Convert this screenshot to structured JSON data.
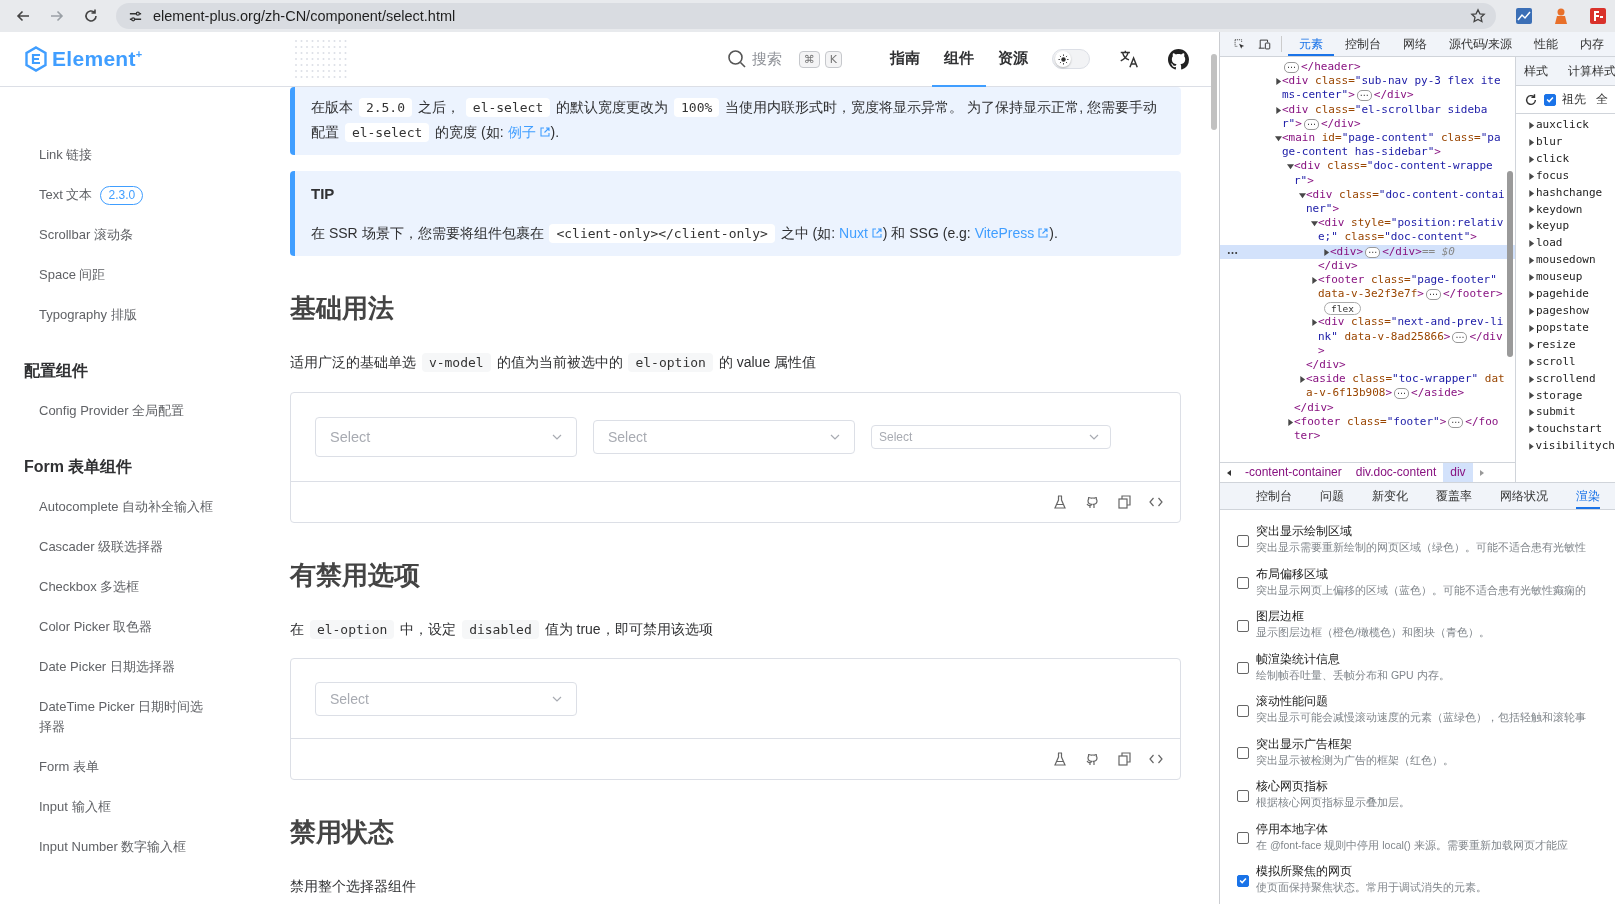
{
  "browser": {
    "url": "element-plus.org/zh-CN/component/select.html"
  },
  "header": {
    "logo": "Element$^{+}$",
    "search": {
      "label": "搜索",
      "keys": [
        "⌘",
        "K"
      ]
    },
    "nav": [
      {
        "label": "指南",
        "selected": false
      },
      {
        "label": "组件",
        "selected": true
      },
      {
        "label": "资源",
        "selected": false
      }
    ],
    "dark_mode": false
  },
  "sidebar": {
    "sections": [
      {
        "items": [
          {
            "label": "Link 链接"
          },
          {
            "label": "Text 文本",
            "badge": "2.3.0"
          },
          {
            "label": "Scrollbar 滚动条"
          },
          {
            "label": "Space 间距"
          },
          {
            "label": "Typography 排版"
          }
        ]
      },
      {
        "title": "配置组件",
        "items": [
          {
            "label": "Config Provider 全局配置"
          }
        ]
      },
      {
        "title": "Form 表单组件",
        "items": [
          {
            "label": "Autocomplete 自动补全输入框"
          },
          {
            "label": "Cascader 级联选择器"
          },
          {
            "label": "Checkbox 多选框"
          },
          {
            "label": "Color Picker 取色器"
          },
          {
            "label": "Date Picker 日期选择器"
          },
          {
            "label": "DateTime Picker 日期时间选择器"
          },
          {
            "label": "Form 表单"
          },
          {
            "label": "Input 输入框"
          },
          {
            "label": "Input Number 数字输入框"
          }
        ]
      }
    ]
  },
  "content": [
    {
      "kind": "callout",
      "segments": [
        {
          "kind": "text",
          "text": "在版本 "
        },
        {
          "kind": "code",
          "text": "2.5.0"
        },
        {
          "kind": "text",
          "text": " 之后， "
        },
        {
          "kind": "code",
          "text": "el-select"
        },
        {
          "kind": "text",
          "text": " 的默认宽度更改为 "
        },
        {
          "kind": "code",
          "text": "100%"
        },
        {
          "kind": "text",
          "text": " 当使用内联形式时，宽度将显示异常。 为了保持显示正常, 您需要手动配置 "
        },
        {
          "kind": "code",
          "text": "el-select"
        },
        {
          "kind": "text",
          "text": " 的宽度 (如: "
        },
        {
          "kind": "link",
          "text": "例子"
        },
        {
          "kind": "text",
          "text": ")."
        }
      ]
    },
    {
      "kind": "callout",
      "title": "TIP",
      "segments": [
        {
          "kind": "text",
          "text": "在 SSR 场景下，您需要将组件包裹在 "
        },
        {
          "kind": "code",
          "text": "<client-only></client-only>"
        },
        {
          "kind": "text",
          "text": " 之中 (如: "
        },
        {
          "kind": "link",
          "text": "Nuxt"
        },
        {
          "kind": "text",
          "text": ") 和 SSG (e.g: "
        },
        {
          "kind": "link",
          "text": "VitePress"
        },
        {
          "kind": "text",
          "text": ")."
        }
      ]
    },
    {
      "kind": "heading",
      "text": "基础用法"
    },
    {
      "kind": "paragraph",
      "segments": [
        {
          "kind": "text",
          "text": "适用广泛的基础单选 "
        },
        {
          "kind": "code",
          "text": "v-model"
        },
        {
          "kind": "text",
          "text": " 的值为当前被选中的 "
        },
        {
          "kind": "code",
          "text": "el-option"
        },
        {
          "kind": "text",
          "text": " 的 value 属性值"
        }
      ]
    },
    {
      "kind": "demo",
      "selects": [
        {
          "placeholder": "Select",
          "kind": "large"
        },
        {
          "placeholder": "Select",
          "kind": "default"
        },
        {
          "placeholder": "Select",
          "kind": "small"
        }
      ]
    },
    {
      "kind": "heading",
      "text": "有禁用选项"
    },
    {
      "kind": "paragraph",
      "segments": [
        {
          "kind": "text",
          "text": "在 "
        },
        {
          "kind": "code",
          "text": "el-option"
        },
        {
          "kind": "text",
          "text": " 中，设定 "
        },
        {
          "kind": "code",
          "text": "disabled"
        },
        {
          "kind": "text",
          "text": " 值为 true，即可禁用该选项"
        }
      ]
    },
    {
      "kind": "demo",
      "selects": [
        {
          "placeholder": "Select",
          "kind": "default"
        }
      ]
    },
    {
      "kind": "heading",
      "text": "禁用状态"
    },
    {
      "kind": "paragraph",
      "segments": [
        {
          "kind": "text",
          "text": "禁用整个选择器组件"
        }
      ]
    }
  ],
  "devtools": {
    "tabs": [
      {
        "label": "元素",
        "selected": true
      },
      {
        "label": "控制台",
        "selected": false
      },
      {
        "label": "网络",
        "selected": false
      },
      {
        "label": "源代码/来源",
        "selected": false
      },
      {
        "label": "性能",
        "selected": false
      },
      {
        "label": "内存",
        "selected": false
      }
    ],
    "tree": [
      {
        "kind": "tail",
        "ellipsis": "⋯",
        "close": "</header>"
      },
      {
        "kind": "element",
        "expanded": false,
        "selected": false,
        "parts": [
          {
            "kind": "tag",
            "text": "<div"
          },
          {
            "kind": "attr",
            "text": " class="
          },
          {
            "kind": "value",
            "text": "\"sub-nav py-3 flex items-center\""
          },
          {
            "kind": "tag",
            "text": ">"
          }
        ],
        "ellipsis": "⋯",
        "close": "</div>"
      },
      {
        "kind": "element",
        "expanded": false,
        "selected": false,
        "parts": [
          {
            "kind": "tag",
            "text": "<div"
          },
          {
            "kind": "attr",
            "text": " class="
          },
          {
            "kind": "value",
            "text": "\"el-scrollbar sidebar\""
          },
          {
            "kind": "tag",
            "text": ">"
          }
        ],
        "ellipsis": "⋯",
        "close": "</div>"
      },
      {
        "kind": "element",
        "expanded": true,
        "selected": false,
        "parts": [
          {
            "kind": "tag",
            "text": "<main"
          },
          {
            "kind": "attr",
            "text": " id="
          },
          {
            "kind": "value",
            "text": "\"page-content\""
          },
          {
            "kind": "attr",
            "text": " class="
          },
          {
            "kind": "value",
            "text": "\"page-content has-sidebar\""
          },
          {
            "kind": "tag",
            "text": ">"
          }
        ],
        "children": [
          {
            "kind": "element",
            "expanded": true,
            "selected": false,
            "parts": [
              {
                "kind": "tag",
                "text": "<div"
              },
              {
                "kind": "attr",
                "text": " class="
              },
              {
                "kind": "value",
                "text": "\"doc-content-wrapper\""
              },
              {
                "kind": "tag",
                "text": ">"
              }
            ],
            "close": "</div>",
            "children": [
              {
                "kind": "element",
                "expanded": true,
                "selected": false,
                "parts": [
                  {
                    "kind": "tag",
                    "text": "<div"
                  },
                  {
                    "kind": "attr",
                    "text": " class="
                  },
                  {
                    "kind": "value",
                    "text": "\"doc-content-container\""
                  },
                  {
                    "kind": "tag",
                    "text": ">"
                  }
                ],
                "close": "</div>",
                "children": [
                  {
                    "kind": "element",
                    "expanded": true,
                    "selected": false,
                    "parts": [
                      {
                        "kind": "tag",
                        "text": "<div"
                      },
                      {
                        "kind": "attr",
                        "text": " style="
                      },
                      {
                        "kind": "value",
                        "text": "\"position:relative;\""
                      },
                      {
                        "kind": "attr",
                        "text": " class="
                      },
                      {
                        "kind": "value",
                        "text": "\"doc-content\""
                      },
                      {
                        "kind": "tag",
                        "text": ">"
                      }
                    ],
                    "close": "</div>",
                    "children": [
                      {
                        "kind": "element",
                        "expanded": false,
                        "selected": true,
                        "parts": [
                          {
                            "kind": "tag",
                            "text": "<div>"
                          }
                        ],
                        "ellipsis": "⋯",
                        "close": "</div>",
                        "reference": "== $0"
                      }
                    ]
                  },
                  {
                    "kind": "element",
                    "expanded": false,
                    "selected": false,
                    "parts": [
                      {
                        "kind": "tag",
                        "text": "<footer"
                      },
                      {
                        "kind": "attr",
                        "text": " class="
                      },
                      {
                        "kind": "value",
                        "text": "\"page-footer\""
                      },
                      {
                        "kind": "attr",
                        "text": " data-v-3e2f3e7f"
                      },
                      {
                        "kind": "tag",
                        "text": ">"
                      }
                    ],
                    "ellipsis": "⋯",
                    "close": "</footer>",
                    "badge": "flex"
                  },
                  {
                    "kind": "element",
                    "expanded": false,
                    "selected": false,
                    "parts": [
                      {
                        "kind": "tag",
                        "text": "<div"
                      },
                      {
                        "kind": "attr",
                        "text": " class="
                      },
                      {
                        "kind": "value",
                        "text": "\"next-and-prev-link\""
                      },
                      {
                        "kind": "attr",
                        "text": " data-v-8ad25866"
                      },
                      {
                        "kind": "tag",
                        "text": ">"
                      }
                    ],
                    "ellipsis": "⋯",
                    "close": "</div>"
                  }
                ]
              },
              {
                "kind": "element",
                "expanded": false,
                "selected": false,
                "parts": [
                  {
                    "kind": "tag",
                    "text": "<aside"
                  },
                  {
                    "kind": "attr",
                    "text": " class="
                  },
                  {
                    "kind": "value",
                    "text": "\"toc-wrapper\""
                  },
                  {
                    "kind": "attr",
                    "text": " data-v-6f13b908"
                  },
                  {
                    "kind": "tag",
                    "text": ">"
                  }
                ],
                "ellipsis": "⋯",
                "close": "</aside>"
              }
            ]
          },
          {
            "kind": "element",
            "expanded": false,
            "selected": false,
            "parts": [
              {
                "kind": "tag",
                "text": "<footer"
              },
              {
                "kind": "attr",
                "text": " class="
              },
              {
                "kind": "value",
                "text": "\"footer\""
              },
              {
                "kind": "tag",
                "text": ">"
              }
            ],
            "ellipsis": "⋯",
            "close": "</footer>"
          }
        ]
      }
    ],
    "side_tabs": [
      "样式",
      "计算样式"
    ],
    "ancestors": {
      "label": "祖先",
      "checked": true
    },
    "show_all": "全",
    "events": [
      "auxclick",
      "blur",
      "click",
      "focus",
      "hashchange",
      "keydown",
      "keyup",
      "load",
      "mousedown",
      "mouseup",
      "pagehide",
      "pageshow",
      "popstate",
      "resize",
      "scroll",
      "scrollend",
      "storage",
      "submit",
      "touchstart",
      "visibilitych"
    ],
    "breadcrumb": [
      {
        "label": "-content-container",
        "selected": false
      },
      {
        "label": "div.doc-content",
        "selected": false
      },
      {
        "label": "div",
        "selected": true
      }
    ],
    "drawer_tabs": [
      {
        "label": "控制台",
        "selected": false
      },
      {
        "label": "问题",
        "selected": false
      },
      {
        "label": "新变化",
        "selected": false
      },
      {
        "label": "覆盖率",
        "selected": false
      },
      {
        "label": "网络状况",
        "selected": false
      },
      {
        "label": "渲染",
        "selected": true
      }
    ],
    "rendering": [
      {
        "title": "突出显示绘制区域",
        "description": "突出显示需要重新绘制的网页区域（绿色）。可能不适合患有光敏性",
        "checked": false
      },
      {
        "title": "布局偏移区域",
        "description": "突出显示网页上偏移的区域（蓝色）。可能不适合患有光敏性癫痫的",
        "checked": false
      },
      {
        "title": "图层边框",
        "description": "显示图层边框（橙色/橄榄色）和图块（青色）。",
        "checked": false
      },
      {
        "title": "帧渲染统计信息",
        "description": "绘制帧吞吐量、丢帧分布和 GPU 内存。",
        "checked": false
      },
      {
        "title": "滚动性能问题",
        "description": "突出显示可能会减慢滚动速度的元素（蓝绿色），包括轻触和滚轮事",
        "checked": false
      },
      {
        "title": "突出显示广告框架",
        "description": "突出显示被检测为广告的框架（红色）。",
        "checked": false
      },
      {
        "title": "核心网页指标",
        "description": "根据核心网页指标显示叠加层。",
        "checked": false
      },
      {
        "title": "停用本地字体",
        "description": "在 @font-face 规则中停用 local() 来源。需要重新加载网页才能应",
        "checked": false
      },
      {
        "title": "模拟所聚焦的网页",
        "description": "使页面保持聚焦状态。常用于调试消失的元素。",
        "checked": true
      }
    ]
  }
}
